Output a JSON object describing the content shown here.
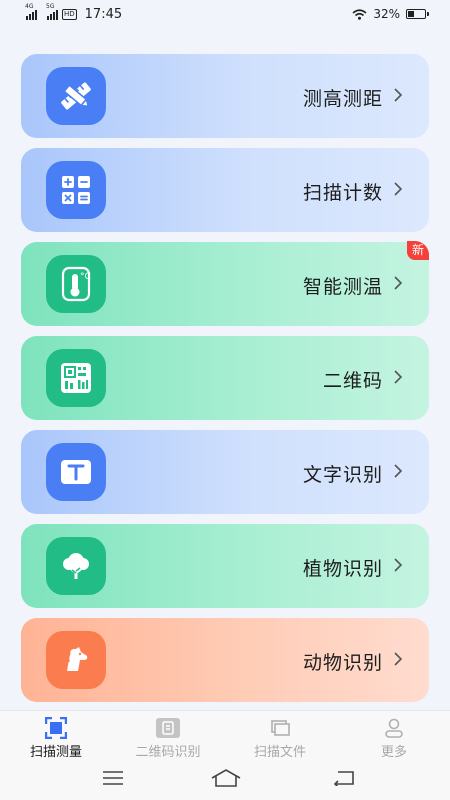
{
  "status_bar": {
    "time": "17:45",
    "net1": "4G",
    "net2": "5G",
    "hd": "HD",
    "battery_text": "32%",
    "battery_level": 0.32
  },
  "cards": [
    {
      "label": "测高测距",
      "icon": "ruler-pencil-icon",
      "theme": "blue"
    },
    {
      "label": "扫描计数",
      "icon": "calculator-icon",
      "theme": "blue"
    },
    {
      "label": "智能测温",
      "icon": "thermometer-icon",
      "theme": "green",
      "badge": "新"
    },
    {
      "label": "二维码",
      "icon": "qr-code-icon",
      "theme": "green"
    },
    {
      "label": "文字识别",
      "icon": "text-recognition-icon",
      "theme": "blue"
    },
    {
      "label": "植物识别",
      "icon": "tree-icon",
      "theme": "green"
    },
    {
      "label": "动物识别",
      "icon": "dog-icon",
      "theme": "orange"
    }
  ],
  "tabs": [
    {
      "label": "扫描测量",
      "icon": "scan-icon",
      "active": true
    },
    {
      "label": "二维码识别",
      "icon": "qr-scan-icon",
      "active": false
    },
    {
      "label": "扫描文件",
      "icon": "document-scan-icon",
      "active": false
    },
    {
      "label": "更多",
      "icon": "profile-icon",
      "active": false
    }
  ]
}
